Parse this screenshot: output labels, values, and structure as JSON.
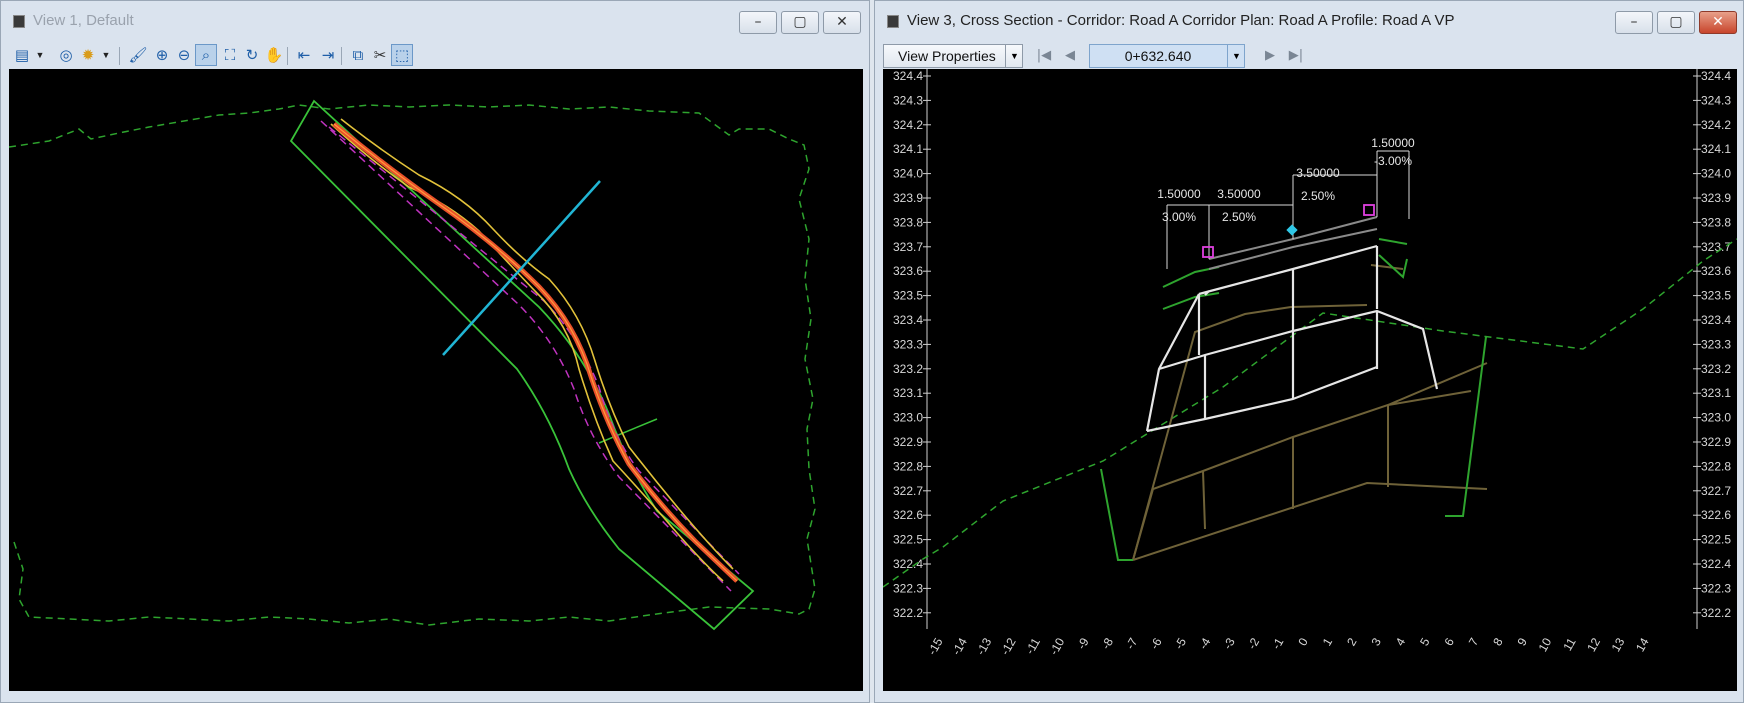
{
  "view1": {
    "title": "View 1, Default",
    "controls": {
      "minimize": "–",
      "maximize": "▢",
      "close": "✕"
    }
  },
  "view3": {
    "title": "View 3, Cross Section - Corridor: Road A Corridor Plan: Road A Profile: Road A VP",
    "controls": {
      "minimize": "–",
      "maximize": "▢",
      "close": "✕"
    },
    "view_properties_label": "View Properties",
    "station_value": "0+632.640",
    "nav": {
      "first": "|◀",
      "prev": "◀",
      "next": "▶",
      "last": "▶|"
    },
    "y_axis_labels": [
      "324.4",
      "324.3",
      "324.2",
      "324.1",
      "324.0",
      "323.9",
      "323.8",
      "323.7",
      "323.6",
      "323.5",
      "323.4",
      "323.3",
      "323.2",
      "323.1",
      "323.0",
      "322.9",
      "322.8",
      "322.7",
      "322.6",
      "322.5",
      "322.4",
      "322.3",
      "322.2"
    ],
    "x_axis_labels": [
      "-15",
      "-14",
      "-13",
      "-12",
      "-11",
      "-10",
      "-9",
      "-8",
      "-7",
      "-6",
      "-5",
      "-4",
      "-3",
      "-2",
      "-1",
      "0",
      "1",
      "2",
      "3",
      "4",
      "5",
      "6",
      "7",
      "8",
      "9",
      "10",
      "11",
      "12",
      "13",
      "14"
    ],
    "dimensions": {
      "left_shoulder_width": "1.50000",
      "left_shoulder_slope": "3.00%",
      "left_lane_width": "3.50000",
      "left_lane_slope": "2.50%",
      "right_lane_width": "3.50000",
      "right_lane_slope": "2.50%",
      "right_shoulder_width": "1.50000",
      "right_shoulder_slope": "-3.00%"
    }
  },
  "colors": {
    "canvas_bg": "#000000",
    "terrain": "#2ea42e",
    "corridor_edge": "#39c239",
    "alignment": "#e8502a",
    "section_line": "#21b5d4",
    "pavement": "#e6e6e6",
    "subbase": "#6f6238",
    "handle": "#e040e0",
    "origin": "#2fc7e6"
  }
}
